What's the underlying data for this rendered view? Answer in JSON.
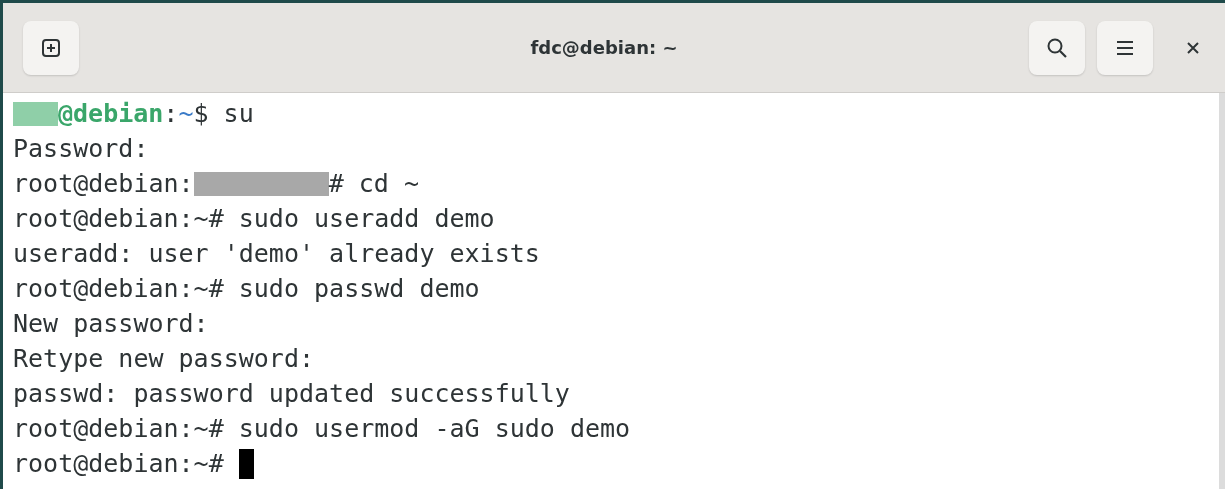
{
  "window": {
    "title": "fdc@debian: ~"
  },
  "terminal": {
    "lines": [
      {
        "segments": [
          {
            "kind": "redacted",
            "color": "#8fcfa8"
          },
          {
            "kind": "user",
            "text": "@debian"
          },
          {
            "kind": "plain",
            "text": ":"
          },
          {
            "kind": "path",
            "text": "~"
          },
          {
            "kind": "plain",
            "text": "$ su"
          }
        ]
      },
      {
        "segments": [
          {
            "kind": "plain",
            "text": "Password:"
          }
        ]
      },
      {
        "segments": [
          {
            "kind": "plain",
            "text": "root@debian:"
          },
          {
            "kind": "redacted",
            "color": "#a8a8a8"
          },
          {
            "kind": "plain",
            "text": "# cd ~"
          }
        ]
      },
      {
        "segments": [
          {
            "kind": "plain",
            "text": "root@debian:~# sudo useradd demo"
          }
        ]
      },
      {
        "segments": [
          {
            "kind": "plain",
            "text": "useradd: user 'demo' already exists"
          }
        ]
      },
      {
        "segments": [
          {
            "kind": "plain",
            "text": "root@debian:~# sudo passwd demo"
          }
        ]
      },
      {
        "segments": [
          {
            "kind": "plain",
            "text": "New password:"
          }
        ]
      },
      {
        "segments": [
          {
            "kind": "plain",
            "text": "Retype new password:"
          }
        ]
      },
      {
        "segments": [
          {
            "kind": "plain",
            "text": "passwd: password updated successfully"
          }
        ]
      },
      {
        "segments": [
          {
            "kind": "plain",
            "text": "root@debian:~# sudo usermod -aG sudo demo"
          }
        ]
      },
      {
        "segments": [
          {
            "kind": "plain",
            "text": "root@debian:~# "
          },
          {
            "kind": "cursor"
          }
        ]
      }
    ]
  }
}
